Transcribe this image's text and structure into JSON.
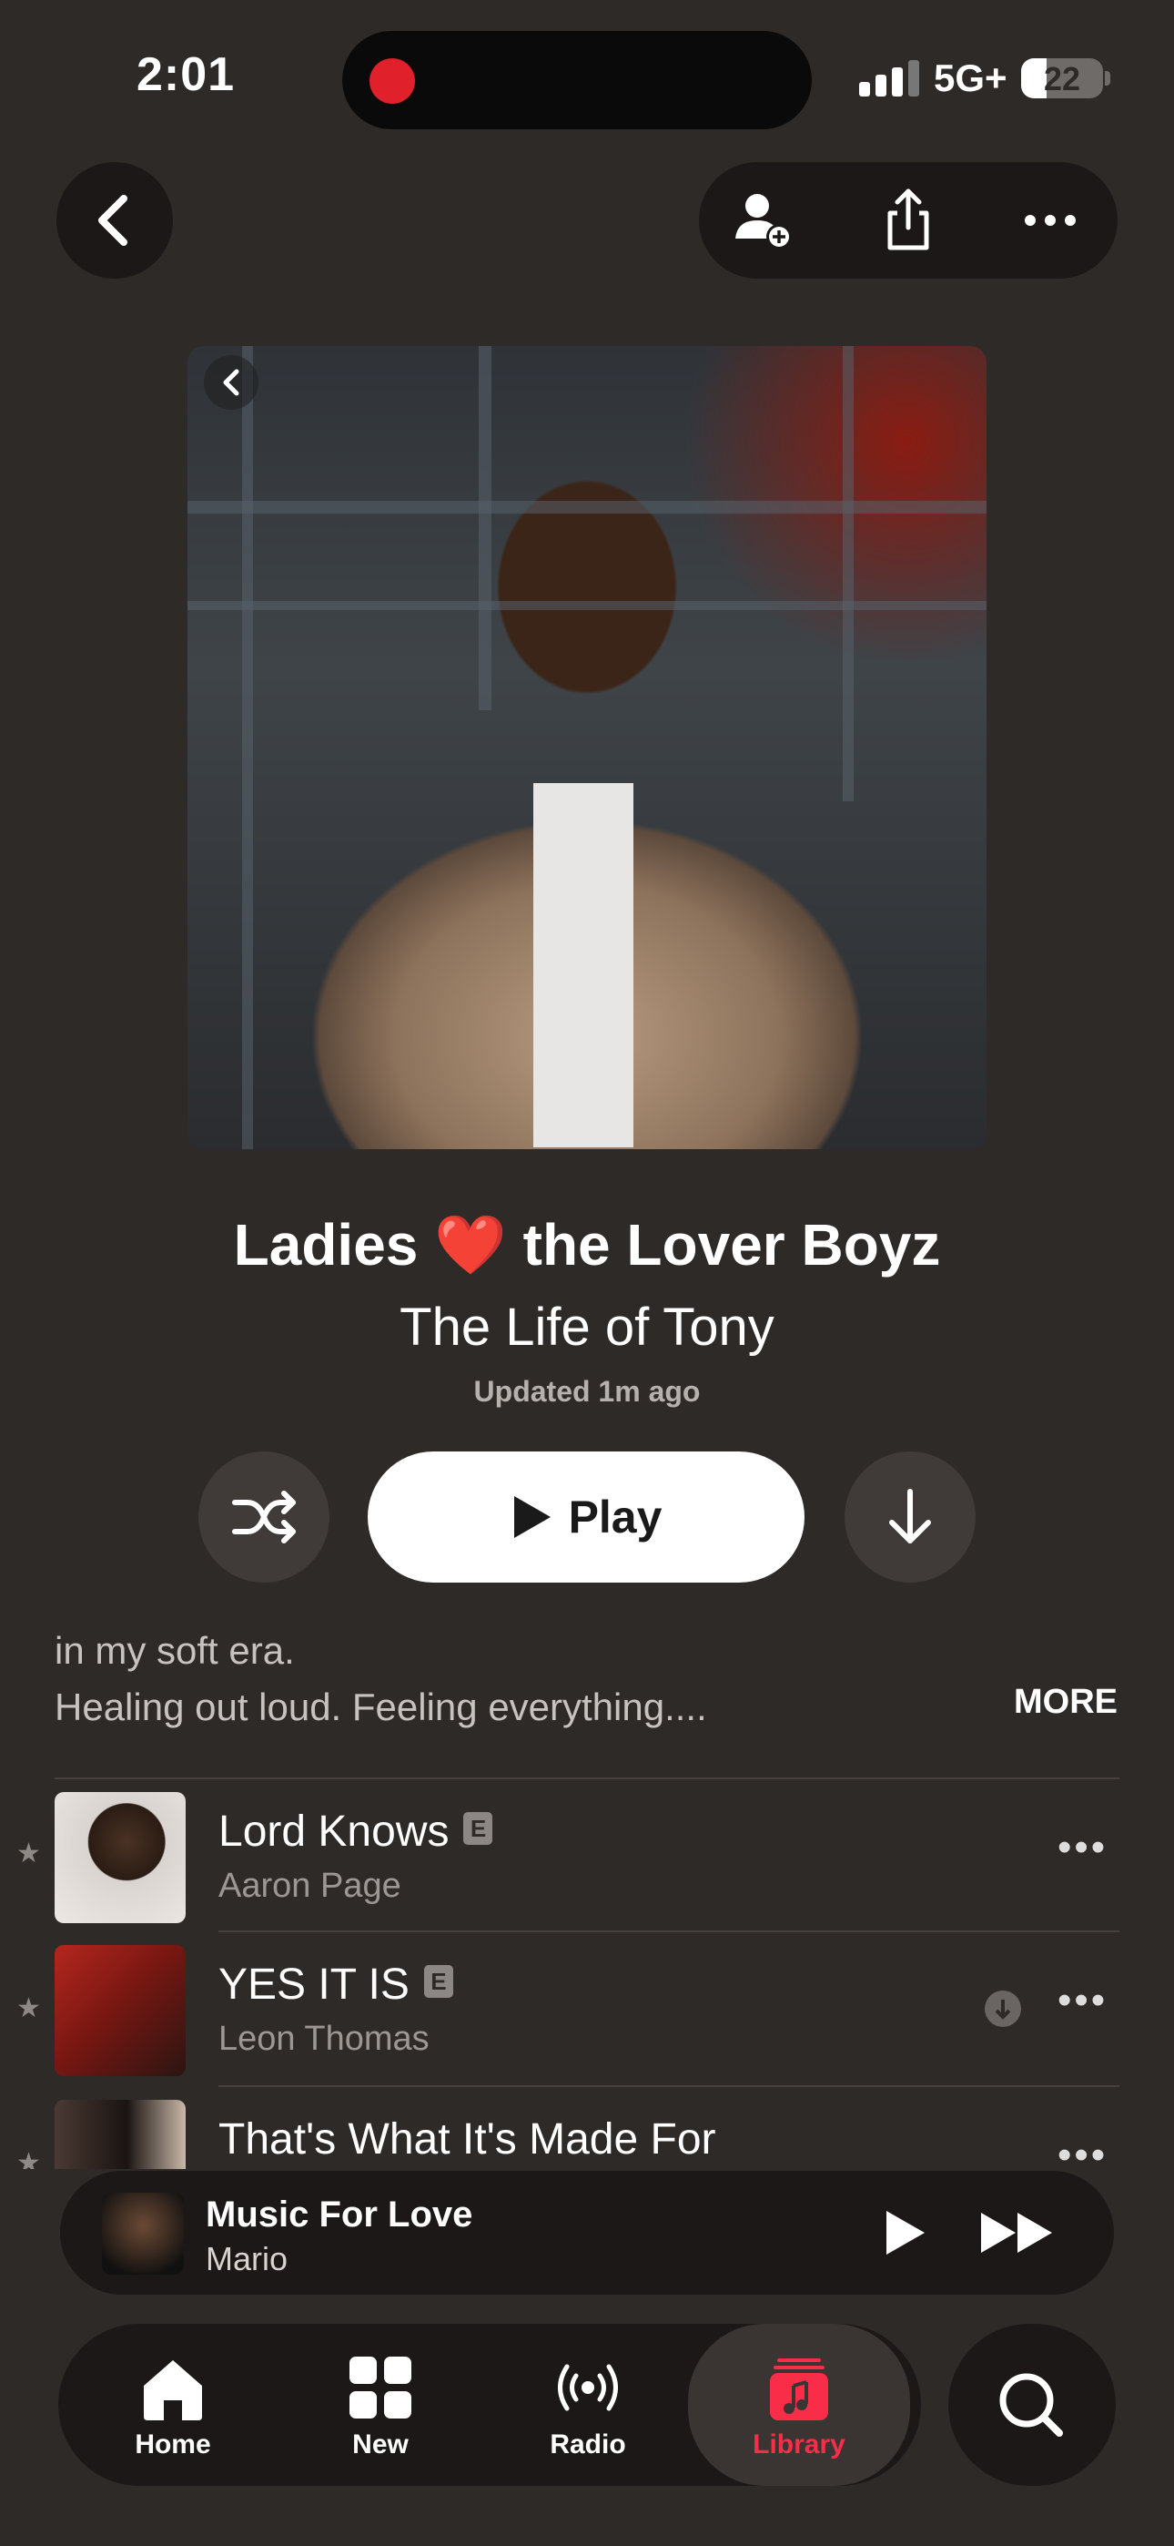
{
  "status_bar": {
    "time": "2:01",
    "network": "5G+",
    "battery": "22"
  },
  "playlist": {
    "title": "Ladies ❤️ the Lover Boyz",
    "curator": "The Life of Tony",
    "updated": "Updated 1m ago",
    "play_label": "Play",
    "description_line1": "in my soft era.",
    "description_line2": "Healing out loud. Feeling everything....",
    "more_label": "MORE"
  },
  "tracks": [
    {
      "title": "Lord Knows",
      "artist": "Aaron Page",
      "explicit": "E",
      "favorite": true,
      "downloaded": false
    },
    {
      "title": "YES IT IS",
      "artist": "Leon Thomas",
      "explicit": "E",
      "favorite": true,
      "downloaded": true
    },
    {
      "title": "That's What It's Made For",
      "artist": "",
      "explicit": "",
      "favorite": true,
      "downloaded": false
    }
  ],
  "now_playing": {
    "title": "Music For Love",
    "artist": "Mario"
  },
  "tabs": [
    {
      "label": "Home",
      "icon": "home-icon",
      "active": false
    },
    {
      "label": "New",
      "icon": "grid-icon",
      "active": false
    },
    {
      "label": "Radio",
      "icon": "radio-icon",
      "active": false
    },
    {
      "label": "Library",
      "icon": "music-note-icon",
      "active": true
    }
  ],
  "colors": {
    "accent": "#fa2d48",
    "background": "#2e2a28",
    "surface": "#1b1817"
  }
}
